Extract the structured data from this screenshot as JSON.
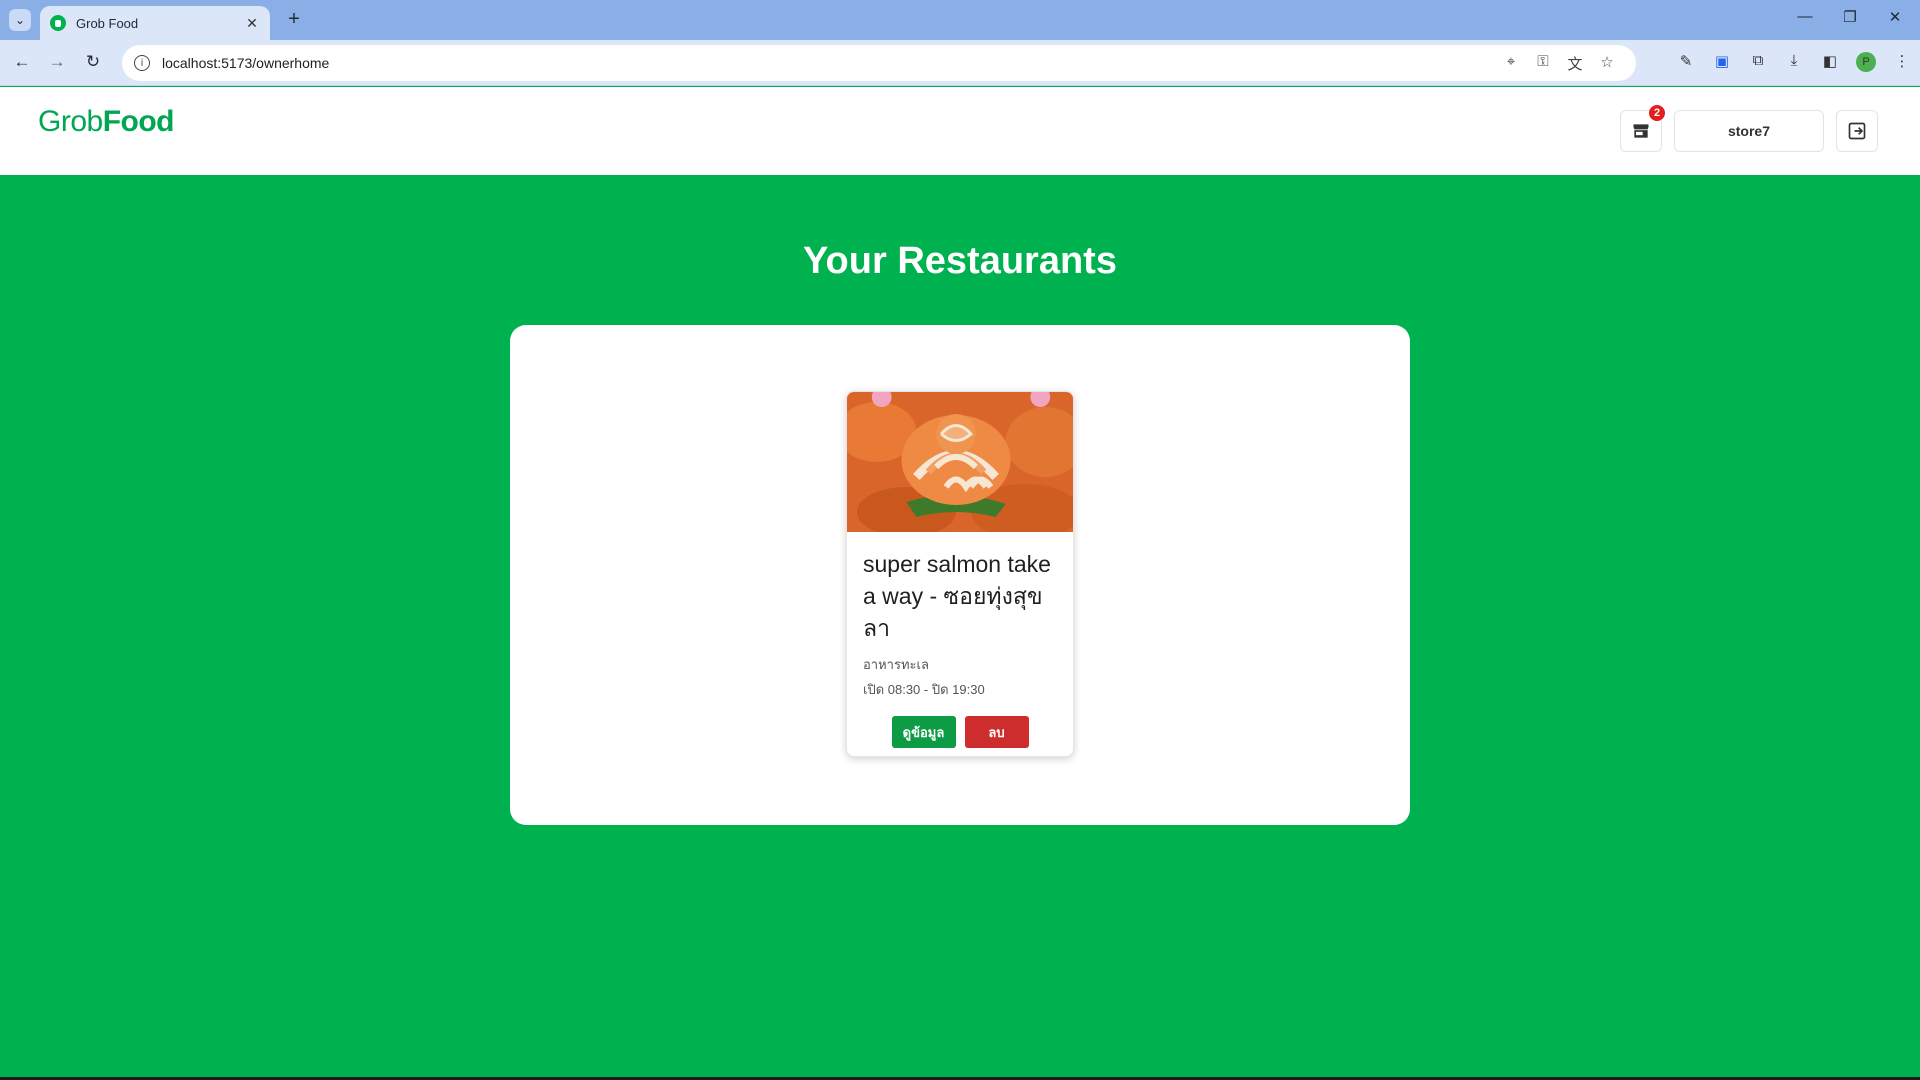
{
  "browser": {
    "tab_title": "Grob Food",
    "url": "localhost:5173/ownerhome",
    "profile_initial": "P"
  },
  "header": {
    "logo_grob": "Grob",
    "logo_food": "Food",
    "notification_count": "2",
    "username": "store7"
  },
  "main": {
    "title": "Your Restaurants",
    "restaurants": [
      {
        "name": "super salmon take a way - ซอยทุ่งสุขลา",
        "category": "อาหารทะเล",
        "hours": "เปิด 08:30 - ปิด 19:30",
        "view_label": "ดูข้อมูล",
        "delete_label": "ลบ"
      }
    ]
  },
  "colors": {
    "brand_green": "#00b14f",
    "view_button": "#0d9b45",
    "delete_button": "#cd2d2d",
    "badge": "#e51d1d"
  }
}
